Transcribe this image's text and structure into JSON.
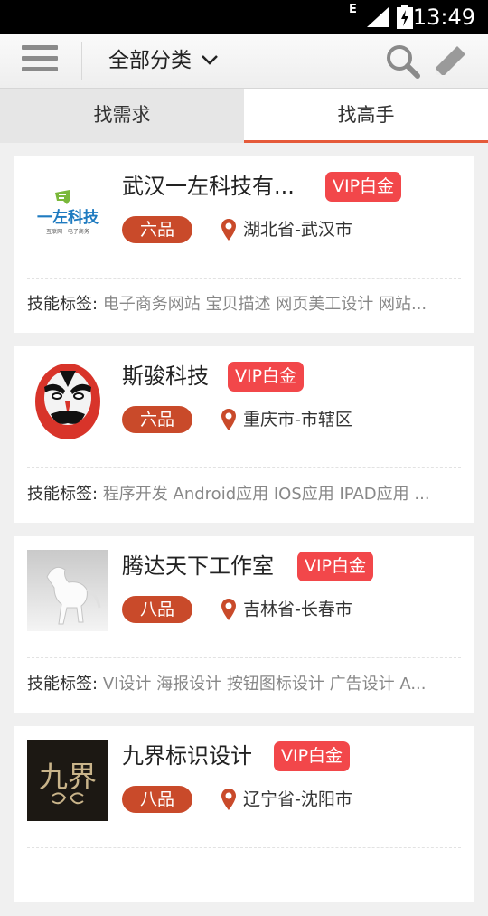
{
  "status_bar": {
    "network": "E",
    "time": "13:49"
  },
  "app_bar": {
    "category": "全部分类"
  },
  "tabs": {
    "left": "找需求",
    "right": "找高手"
  },
  "skills_label": "技能标签:",
  "cards": [
    {
      "name": "武汉一左科技有...",
      "vip": "VIP白金",
      "rank": "六品",
      "location": "湖北省-武汉市",
      "skills": "电子商务网站 宝贝描述 网页美工设计 网站...",
      "logo_text": "一左科技",
      "logo_sub": "互联网 · 电子商务"
    },
    {
      "name": "斯骏科技",
      "vip": "VIP白金",
      "rank": "六品",
      "location": "重庆市-市辖区",
      "skills": "程序开发 Android应用 IOS应用 IPAD应用 ..."
    },
    {
      "name": "腾达天下工作室",
      "vip": "VIP白金",
      "rank": "八品",
      "location": "吉林省-长春市",
      "skills": "VI设计 海报设计 按钮图标设计 广告设计 A..."
    },
    {
      "name": "九界标识设计",
      "vip": "VIP白金",
      "rank": "八品",
      "location": "辽宁省-沈阳市",
      "logo_text": "九界"
    }
  ],
  "colors": {
    "accent": "#e55a3a",
    "vip": "#f2474a",
    "rank": "#c94a2a",
    "pin": "#c94a2a"
  }
}
